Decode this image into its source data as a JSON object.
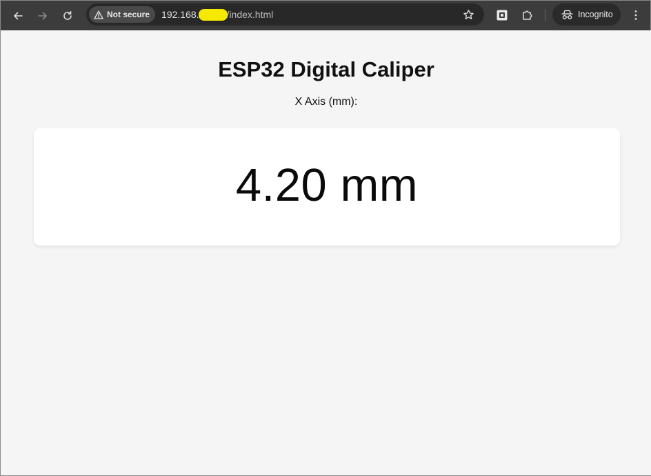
{
  "browser": {
    "security_chip": {
      "icon": "warning-triangle-icon",
      "label": "Not secure"
    },
    "url": {
      "host_prefix": "192.168.",
      "path": "/index.html",
      "redaction_color": "#f5e900"
    },
    "profile_label": "Incognito",
    "icons": [
      "back-arrow-icon",
      "forward-arrow-icon",
      "reload-icon",
      "bookmark-star-icon",
      "screenshot-icon",
      "extensions-puzzle-icon",
      "incognito-icon",
      "more-vert-icon"
    ]
  },
  "page": {
    "title": "ESP32 Digital Caliper",
    "axis_label": "X Axis (mm):",
    "reading": "4.20 mm"
  },
  "colors": {
    "toolbar_bg": "#3c3c3c",
    "omnibox_bg": "#282828",
    "page_bg": "#f5f5f5",
    "card_bg": "#ffffff"
  }
}
